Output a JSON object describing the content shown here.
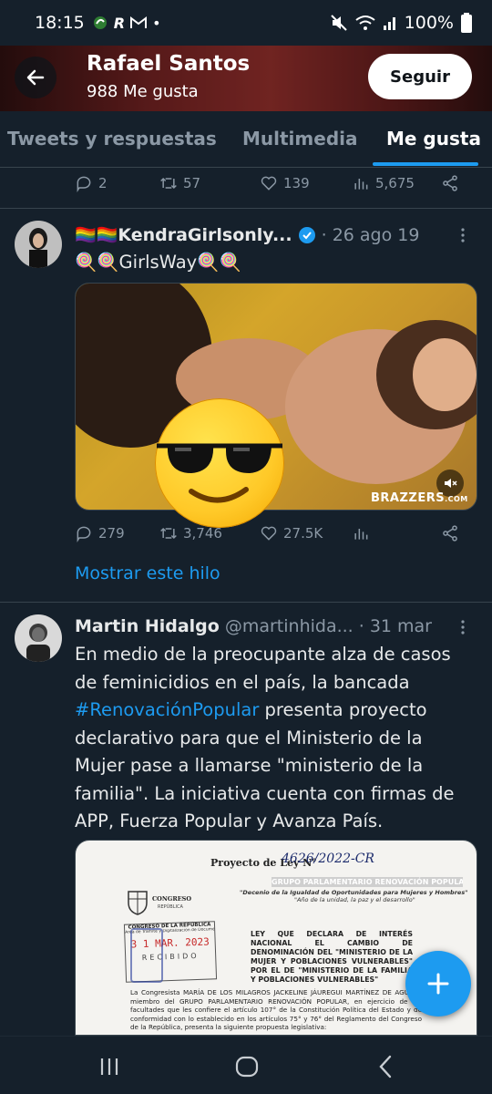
{
  "status_bar": {
    "time": "18:15",
    "battery": "100%"
  },
  "header": {
    "title": "Rafael Santos",
    "subtitle": "988 Me gusta",
    "follow_label": "Seguir"
  },
  "tabs": [
    {
      "label": "Tweets y respuestas",
      "active": false
    },
    {
      "label": "Multimedia",
      "active": false
    },
    {
      "label": "Me gusta",
      "active": true
    }
  ],
  "prev_tweet": {
    "replies": "2",
    "retweets": "57",
    "likes": "139",
    "views": "5,675"
  },
  "tweet1": {
    "name": "🏳️‍🌈🏳️‍🌈KendraGirlsonly...",
    "date": "· 26 ago 19",
    "text": "🍭🍭GirlsWay🍭🍭",
    "media_watermark": "BRAZZERS",
    "media_watermark_suffix": ".COM",
    "replies": "279",
    "retweets": "3,746",
    "likes": "27.5K",
    "thread_link": "Mostrar este hilo"
  },
  "tweet2": {
    "name": "Martin Hidalgo",
    "handle": "@martinhida...",
    "date": "· 31 mar",
    "text_before": "En medio de la preocupante alza de casos de feminicidios en el país, la bancada ",
    "hashtag": "#RenovaciónPopular",
    "text_after": " presenta proyecto declarativo para que el Ministerio de la Mujer pase a llamarse \"ministerio de la familia\". La iniciativa cuenta con firmas de APP, Fuerza Popular y Avanza País.",
    "doc": {
      "project_label": "Proyecto de Ley N°",
      "project_number": "4626/2022-CR",
      "group_header": "GRUPO PARLAMENTARIO RENOVACIÓN POPULAR",
      "decenio": "\"Decenio de la Igualdad de Oportunidades para Mujeres y Hombres\"",
      "year_motto": "\"Año de la unidad, la paz y el desarrollo\"",
      "congreso": "CONGRESO",
      "republica": "REPÚBLICA",
      "stamp_title": "CONGRESO DE LA REPÚBLICA",
      "stamp_area": "Área de Trámite y Digitalización de Documentos",
      "stamp_date": "3 1 MAR. 2023",
      "stamp_received": "RECIBIDO",
      "law_title": "LEY QUE DECLARA DE INTERÉS NACIONAL EL CAMBIO DE DENOMINACIÓN DEL \"MINISTERIO DE LA MUJER Y POBLACIONES VULNERABLES\" POR EL DE \"MINISTERIO DE LA FAMILIA Y POBLACIONES VULNERABLES\"",
      "body": "La Congresista MARÍA DE LOS MILAGROS JACKELINE JÁUREGUI MARTÍNEZ DE AGUAYO miembro del GRUPO PARLAMENTARIO RENOVACIÓN POPULAR, en ejercicio de las facultades que les confiere el artículo 107° de la Constitución Política del Estado y de conformidad con lo establecido en los artículos 75° y 76° del Reglamento del Congreso de la República, presenta la siguiente propuesta legislativa:"
    }
  },
  "colors": {
    "background": "#15202b",
    "accent": "#1d9bf0",
    "muted": "#8b98a5"
  }
}
